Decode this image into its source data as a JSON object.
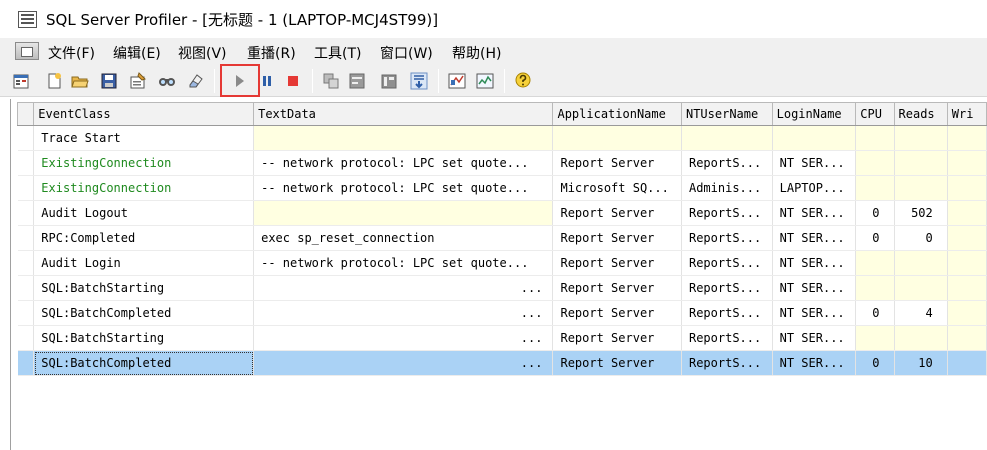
{
  "window": {
    "title": "SQL Server Profiler - [无标题 - 1 (LAPTOP-MCJ4ST99)]"
  },
  "menu": {
    "items": [
      {
        "label": "文件(F)"
      },
      {
        "label": "编辑(E)"
      },
      {
        "label": "视图(V)"
      },
      {
        "label": "重播(R)"
      },
      {
        "label": "工具(T)"
      },
      {
        "label": "窗口(W)"
      },
      {
        "label": "帮助(H)"
      }
    ]
  },
  "toolbar": {
    "icons": [
      "new-trace-icon",
      "new-template-icon",
      "open-icon",
      "save-icon",
      "properties-icon",
      "find-icon",
      "clear-icon",
      "run-trace-icon",
      "pause-trace-icon",
      "stop-trace-icon",
      "auto-scroll-icon",
      "grouped-view-icon",
      "aggregated-view-icon",
      "scroll-icon",
      "sql-profiler-icon",
      "activity-monitor-icon",
      "help-icon"
    ],
    "highlighted": "run-trace-icon",
    "highlight_color": "#e53935"
  },
  "grid": {
    "columns": [
      "EventClass",
      "TextData",
      "ApplicationName",
      "NTUserName",
      "LoginName",
      "CPU",
      "Reads",
      "Wri"
    ],
    "rows": [
      {
        "event": "Trace Start",
        "text": "",
        "app": "",
        "ntuser": "",
        "login": "",
        "cpu": "",
        "reads": "",
        "writes": "",
        "event_color": "normal",
        "selected": false
      },
      {
        "event": "ExistingConnection",
        "text": "-- network protocol: LPC  set quote...",
        "app": "Report Server",
        "ntuser": "ReportS...",
        "login": "NT SER...",
        "cpu": "",
        "reads": "",
        "writes": "",
        "event_color": "green",
        "selected": false
      },
      {
        "event": "ExistingConnection",
        "text": "-- network protocol: LPC  set quote...",
        "app": "Microsoft SQ...",
        "ntuser": "Adminis...",
        "login": "LAPTOP...",
        "cpu": "",
        "reads": "",
        "writes": "",
        "event_color": "green",
        "selected": false
      },
      {
        "event": "Audit Logout",
        "text": "",
        "app": "Report Server",
        "ntuser": "ReportS...",
        "login": "NT SER...",
        "cpu": "0",
        "reads": "502",
        "writes": "",
        "event_color": "normal",
        "selected": false
      },
      {
        "event": "RPC:Completed",
        "text": "exec sp_reset_connection",
        "app": "Report Server",
        "ntuser": "ReportS...",
        "login": "NT SER...",
        "cpu": "0",
        "reads": "0",
        "writes": "",
        "event_color": "normal",
        "selected": false
      },
      {
        "event": "Audit Login",
        "text": "-- network protocol: LPC  set quote...",
        "app": "Report Server",
        "ntuser": "ReportS...",
        "login": "NT SER...",
        "cpu": "",
        "reads": "",
        "writes": "",
        "event_color": "normal",
        "selected": false
      },
      {
        "event": "SQL:BatchStarting",
        "text": "...",
        "app": "Report Server",
        "ntuser": "ReportS...",
        "login": "NT SER...",
        "cpu": "",
        "reads": "",
        "writes": "",
        "event_color": "normal",
        "selected": false
      },
      {
        "event": "SQL:BatchCompleted",
        "text": "...",
        "app": "Report Server",
        "ntuser": "ReportS...",
        "login": "NT SER...",
        "cpu": "0",
        "reads": "4",
        "writes": "",
        "event_color": "normal",
        "selected": false
      },
      {
        "event": "SQL:BatchStarting",
        "text": "...",
        "app": "Report Server",
        "ntuser": "ReportS...",
        "login": "NT SER...",
        "cpu": "",
        "reads": "",
        "writes": "",
        "event_color": "normal",
        "selected": false
      },
      {
        "event": "SQL:BatchCompleted",
        "text": "...",
        "app": "Report Server",
        "ntuser": "ReportS...",
        "login": "NT SER...",
        "cpu": "0",
        "reads": "10",
        "writes": "",
        "event_color": "normal",
        "selected": true
      }
    ]
  },
  "colors": {
    "empty_cell": "#ffffe1",
    "selected_row": "#aad2f5",
    "existing_connection_text": "#1f8a1f"
  }
}
